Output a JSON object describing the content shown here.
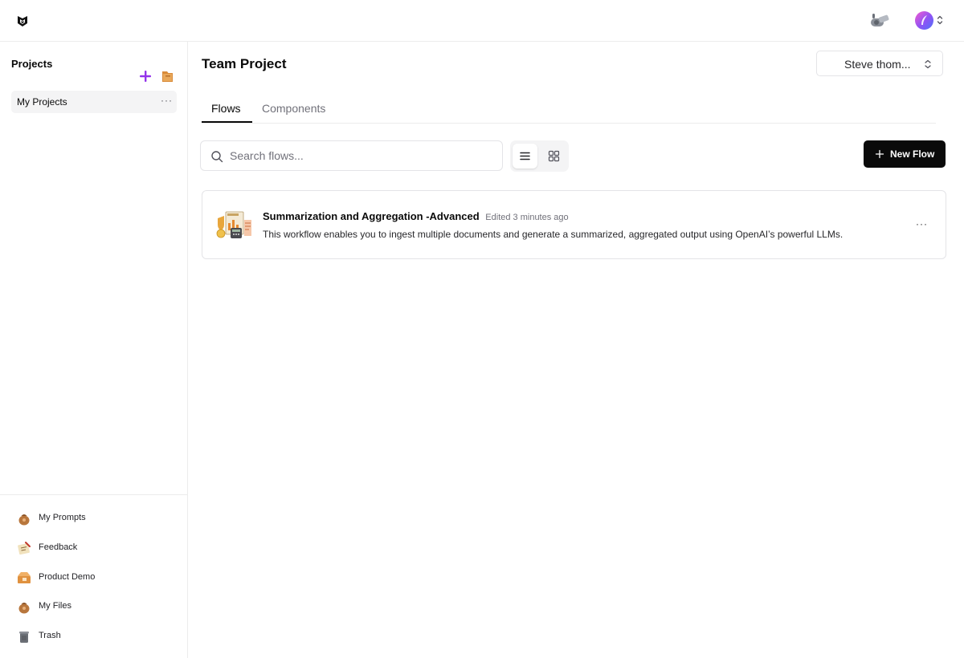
{
  "sidebar": {
    "title": "Projects",
    "projects": [
      {
        "label": "My Projects",
        "menu": "···"
      }
    ],
    "bottom_nav": [
      {
        "label": "My Prompts",
        "icon": "prompts-bag-icon"
      },
      {
        "label": "Feedback",
        "icon": "feedback-notepad-icon"
      },
      {
        "label": "Product Demo",
        "icon": "demo-box-icon"
      },
      {
        "label": "My Files",
        "icon": "files-bag-icon"
      },
      {
        "label": "Trash",
        "icon": "trash-icon"
      }
    ]
  },
  "header": {
    "user_selector": "Steve thom..."
  },
  "main": {
    "title": "Team Project",
    "tabs": [
      {
        "label": "Flows",
        "active": true
      },
      {
        "label": "Components",
        "active": false
      }
    ],
    "search": {
      "placeholder": "Search flows...",
      "value": ""
    },
    "new_flow_label": "New Flow",
    "flows": [
      {
        "title": "Summarization and Aggregation -Advanced",
        "edited": "Edited 3 minutes ago",
        "description": "This workflow enables you to ingest multiple documents and generate a summarized, aggregated output using  OpenAI’s powerful LLMs.",
        "menu": "···"
      }
    ]
  },
  "colors": {
    "accent": "#0a0a0a",
    "add_icon": "#9333ea",
    "muted_text": "#71717a",
    "border": "#e4e4e7"
  }
}
